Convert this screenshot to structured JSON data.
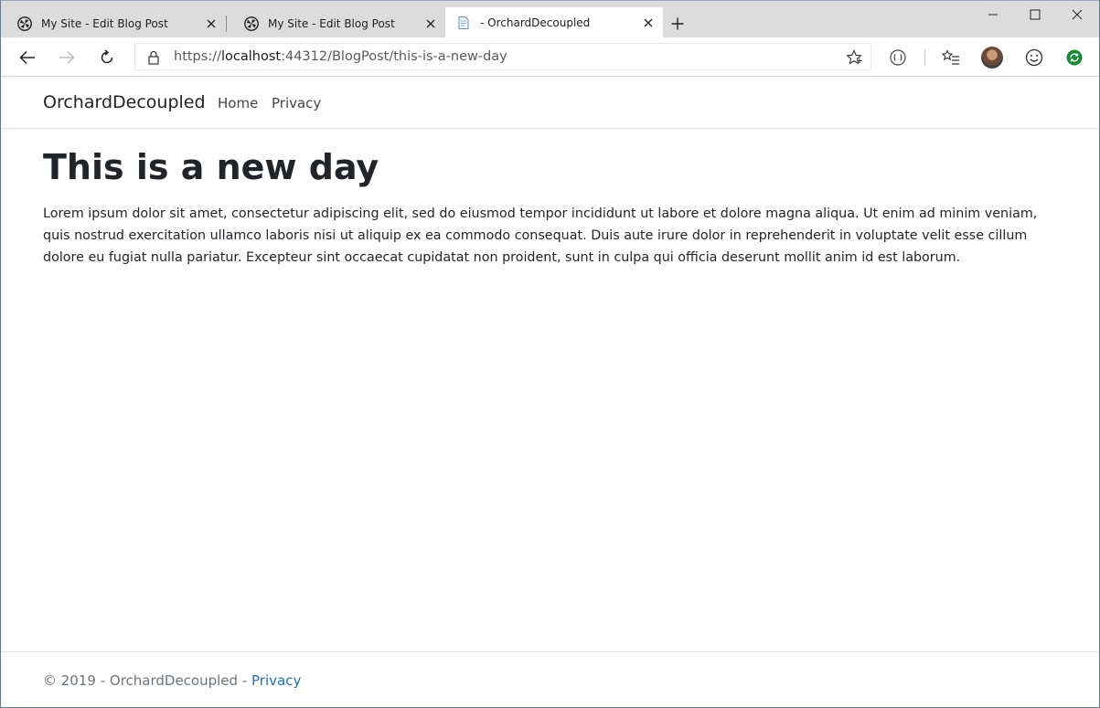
{
  "browser": {
    "tabs": [
      {
        "title": "My Site - Edit Blog Post",
        "icon": "orchard-icon"
      },
      {
        "title": "My Site - Edit Blog Post",
        "icon": "orchard-icon"
      },
      {
        "title": "- OrchardDecoupled",
        "icon": "page-icon",
        "active": true
      }
    ],
    "address": {
      "scheme": "https://",
      "host": "localhost",
      "path": ":44312/BlogPost/this-is-a-new-day"
    },
    "profile_status_color": "#1a8a3a"
  },
  "site": {
    "brand": "OrchardDecoupled",
    "nav": {
      "home": "Home",
      "privacy": "Privacy"
    }
  },
  "post": {
    "title": "This is a new day",
    "body": "Lorem ipsum dolor sit amet, consectetur adipiscing elit, sed do eiusmod tempor incididunt ut labore et dolore magna aliqua. Ut enim ad minim veniam, quis nostrud exercitation ullamco laboris nisi ut aliquip ex ea commodo consequat. Duis aute irure dolor in reprehenderit in voluptate velit esse cillum dolore eu fugiat nulla pariatur. Excepteur sint occaecat cupidatat non proident, sunt in culpa qui officia deserunt mollit anim id est laborum."
  },
  "footer": {
    "text": "© 2019 - OrchardDecoupled - ",
    "privacy_link": "Privacy"
  },
  "colors": {
    "link": "#1e6fb8",
    "heading": "#212529",
    "muted": "#6c757d"
  }
}
